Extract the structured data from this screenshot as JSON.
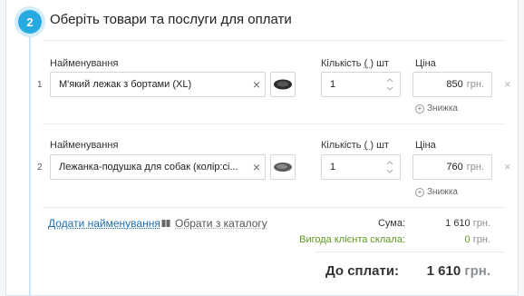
{
  "step": {
    "number": "2",
    "title": "Оберіть товари та послуги для оплати"
  },
  "labels": {
    "name": "Найменування",
    "quantity": "Кількість",
    "unit_open": "(",
    "unit_close": ")",
    "unit": "шт",
    "price": "Ціна"
  },
  "rows": [
    {
      "index": "1",
      "name": "М'який лежак з бортами (XL)",
      "quantity": "1",
      "price": "850",
      "currency": "грн.",
      "discount_label": "Знижка"
    },
    {
      "index": "2",
      "name": "Лежанка-подушка для собак (колір:сі...",
      "quantity": "1",
      "price": "760",
      "currency": "грн.",
      "discount_label": "Знижка"
    }
  ],
  "actions": {
    "add_item": "Додати найменування",
    "from_catalog": "Обрати з каталогу"
  },
  "summary": {
    "sum_label": "Сума:",
    "sum_value": "1 610",
    "sum_currency": "грн.",
    "benefit_label": "Вигода клієнта склала:",
    "benefit_value": "0",
    "benefit_currency": "грн.",
    "total_label": "До сплати:",
    "total_value": "1 610",
    "total_currency": "грн."
  },
  "colors": {
    "accent": "#27a9e1",
    "link": "#1e6fb5",
    "benefit": "#5b9a1e"
  }
}
